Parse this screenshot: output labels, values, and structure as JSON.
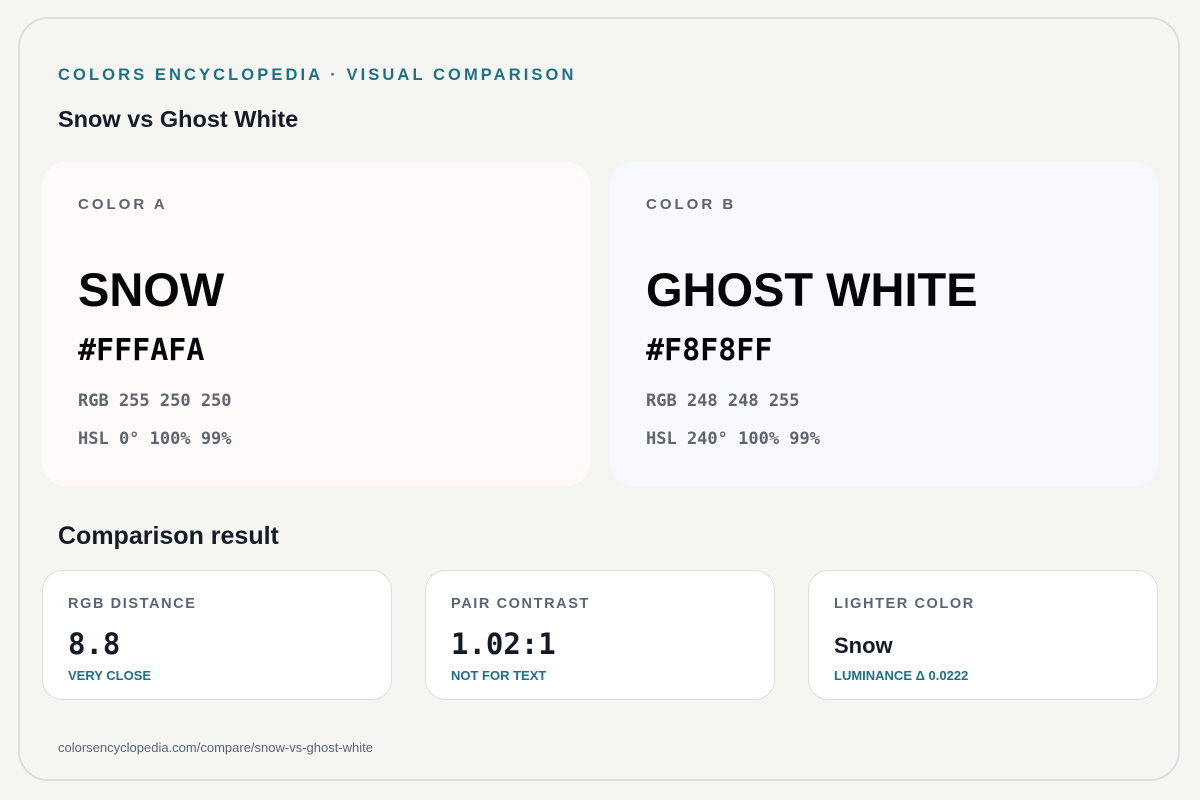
{
  "header": {
    "eyebrow": "COLORS ENCYCLOPEDIA · VISUAL COMPARISON",
    "title": "Snow vs Ghost White"
  },
  "colors": [
    {
      "label": "COLOR A",
      "name": "SNOW",
      "hex": "#FFFAFA",
      "rgb": "RGB 255 250 250",
      "hsl": "HSL 0° 100% 99%",
      "swatch_color": "#FFFAFA"
    },
    {
      "label": "COLOR B",
      "name": "GHOST WHITE",
      "hex": "#F8F8FF",
      "rgb": "RGB 248 248 255",
      "hsl": "HSL 240° 100% 99%",
      "swatch_color": "#F8F8FF"
    }
  ],
  "comparison": {
    "title": "Comparison result",
    "metrics": [
      {
        "label": "RGB DISTANCE",
        "value": "8.8",
        "sub": "VERY CLOSE"
      },
      {
        "label": "PAIR CONTRAST",
        "value": "1.02:1",
        "sub": "NOT FOR TEXT"
      },
      {
        "label": "LIGHTER COLOR",
        "value": "Snow",
        "sub": "LUMINANCE Δ 0.0222"
      }
    ]
  },
  "footer": {
    "url": "colorsencyclopedia.com/compare/snow-vs-ghost-white"
  },
  "theme": {
    "accent": "#1F6F86",
    "background": "#F5F6F2",
    "text": "#141B26"
  }
}
